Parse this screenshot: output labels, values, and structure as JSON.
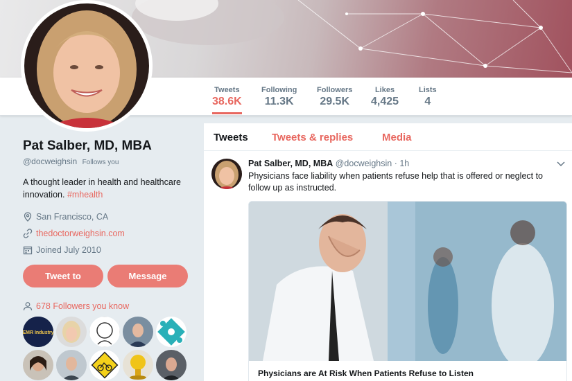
{
  "profile": {
    "name": "Pat Salber, MD, MBA",
    "handle": "@docweighsin",
    "follows_you": "Follows you",
    "bio_text": "A thought leader in health and healthcare innovation. ",
    "bio_hashtag": "#mhealth",
    "location": "San Francisco, CA",
    "website": "thedoctorweighsin.com",
    "joined": "Joined July 2010",
    "tweet_to_label": "Tweet to",
    "message_label": "Message",
    "followers_you_know": "678 Followers you know"
  },
  "stats": [
    {
      "label": "Tweets",
      "value": "38.6K"
    },
    {
      "label": "Following",
      "value": "11.3K"
    },
    {
      "label": "Followers",
      "value": "29.5K"
    },
    {
      "label": "Likes",
      "value": "4,425"
    },
    {
      "label": "Lists",
      "value": "4"
    }
  ],
  "tabs": [
    "Tweets",
    "Tweets & replies",
    "Media"
  ],
  "tweet": {
    "name": "Pat Salber, MD, MBA",
    "handle": "@docweighsin",
    "time": " · 1h",
    "text": "Physicians face liability when patients refuse help that is offered or neglect to follow up as instructed.",
    "card_title": "Physicians are At Risk When Patients Refuse to Listen"
  },
  "colors": {
    "accent": "#e8675f",
    "button": "#ea7c75",
    "muted": "#657786"
  }
}
